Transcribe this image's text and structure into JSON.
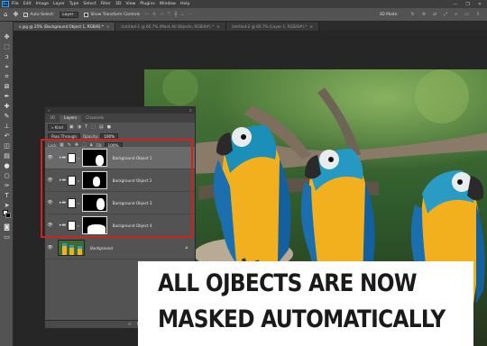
{
  "app": {
    "logo_text": "Ps"
  },
  "menubar": {
    "items": [
      "File",
      "Edit",
      "Image",
      "Layer",
      "Type",
      "Select",
      "Filter",
      "3D",
      "View",
      "Plugins",
      "Window",
      "Help"
    ],
    "window_controls": [
      "—",
      "❐",
      "✕"
    ]
  },
  "options_bar": {
    "auto_select_label": "Auto-Select:",
    "auto_select_target": "Layer",
    "show_transform_label": "Show Transform Controls",
    "mode_3d_label": "3D Mode:"
  },
  "tabs": [
    {
      "label": "s.jpg @ 25% (Background Object 1, RGB/8) *",
      "active": true
    },
    {
      "label": "Untitled-1 @ 66.7% (Mask All Objects, RGB/8#) *",
      "active": false
    },
    {
      "label": "Untitled-2 @ 66.7% (Layer 1, RGB/8#) *",
      "active": false
    }
  ],
  "layers_panel": {
    "tabs": [
      "Layers",
      "Channels"
    ],
    "active_tab": "Layers",
    "kind_label": "Kind",
    "blend_mode": "Pass Through",
    "opacity_label": "Opacity:",
    "opacity_value": "100%",
    "lock_label": "Lock:",
    "fill_label": "Fill:",
    "fill_value": "100%",
    "layers": [
      {
        "name": "Background Object 1",
        "active": true
      },
      {
        "name": "Background Object 2",
        "active": false
      },
      {
        "name": "Background Object 3",
        "active": false
      },
      {
        "name": "Background Object 4",
        "active": false
      },
      {
        "name": "Background",
        "active": false
      }
    ]
  },
  "caption": {
    "line1": "ALL OJBECTS ARE NOW",
    "line2": "MASKED AUTOMATICALLY"
  },
  "colors": {
    "highlight": "#d1231c",
    "panel_bg": "#535353",
    "menubar_bg": "#3d3d3d"
  }
}
